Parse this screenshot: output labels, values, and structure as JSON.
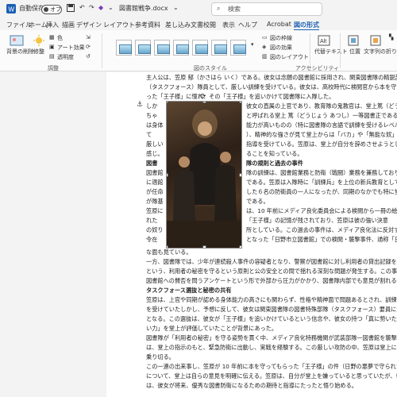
{
  "titlebar": {
    "autosave_label": "自動保存",
    "autosave_state": "オフ",
    "filename": "図書館戦争.docx",
    "search_placeholder": "検索"
  },
  "menus": [
    "ファイル",
    "ホーム",
    "挿入",
    "描画",
    "デザイン",
    "レイアウト",
    "参考資料",
    "差し込み文書",
    "校閲",
    "表示",
    "ヘルプ",
    "Acrobat",
    "図の形式"
  ],
  "active_menu": "図の形式",
  "ribbon": {
    "remove_bg": "背景の削除",
    "corrections": "修整",
    "color": "色",
    "art_effects": "アート効果",
    "transparency": "透明度",
    "group_adjust": "調整",
    "group_styles": "図のスタイル",
    "picture_border": "図の枠線",
    "picture_effects": "図の効果",
    "picture_layout": "図のレイアウト",
    "alt_text": "代替テキスト",
    "group_accessibility": "アクセシビリティ",
    "position": "位置",
    "wrap_text": "文字列の折り返し"
  },
  "doc": {
    "lines": [
      "主人公は、笠原 郁（かさはら いく）である。彼女は念願の図書館に採用され、関東図書隊の精鋭部隊",
      "（タスクフォース）隊員として、厳しい訓練を受けている。彼女は、高校時代に検閲官から本を守",
      "った「王子様」に憧れ、その「王子様」を追いかけて図書隊に入隊した。"
    ],
    "wrap_lines": [
      "しか",
      "ちゃ",
      "は身体",
      "て",
      "厳しい",
      "感じ。",
      "図書",
      "図書館",
      "に適館",
      "が任命",
      "が隊基",
      "笠原に",
      "れた",
      "の奴り",
      "令在"
    ],
    "right_lines": [
      "彼女の直属の上官であり、教育隊の鬼教官は、堂上篤（どうじょう あつし）",
      "と呼ばれる堂上 篤（どうじょう あつし）一等図書正である。",
      "能力が高いものの（特に図書隊の言語で訓練を受けるレベル",
      "）、精神的な強さが見て堂上からは「バカ」や「無能な奴」",
      "指導を受けている。笠原は、堂上が自分を辞めさせようとしてい",
      "ることを知っている。",
      "隊の規則と過去の事件",
      "隊の訓練は、図書館業務と防衛（戦闘）業務を兼務しており、",
      "である。笠原は入隊時に「訓練兵」を上位の新兵教育として、堂上",
      "した６名の防衛員の一人になったが、同期のなかでも特に堂上と",
      "である。",
      "は、10 年前にメディア良化委員会による検閲から一冊の絵本を",
      "「王子様」の記憶が残されており、笠原は彼の強い決意",
      "所としている。この過去の事件は、メディア良化法に反対するシン",
      "となった「日野市立図書館」での検閲・襲撃事件、通称「日野の"
    ],
    "bottom_lines": [
      "な面も見ている。",
      "一方、図書隊では、少年が連続殺人事件の容疑者となり、警察が図書館に対し利用者の貸出記録を要求",
      "という、利用者の秘密を守るという原則と公の安全との間で揺れる深刻な問題が発生する。この事件は、図",
      "図書館への賛否を問うアンケートという形で外部から圧力がかかり、図書隊内部でも意見が割れる微妙な状況",
      "タスクフォース選抜と秘密の共有",
      "笠原は、上官や同期が認める身体能力の高さにも関わらず、性格や精神面で問題あるとされ、訓練では厳",
      "を受けていたしかし、予想に反して、彼女は関東図書隊の図書特殊部隊（タスクフォース）要員に選抜",
      "となる。この選抜は、彼女が「王子様」を追いかけているという信念や、彼女の持つ「真に勢いた者にしか持",
      "い力」を堂上が評価していたことが背景にあった。",
      "図書隊が「利用者の秘密」を守る姿勢を貫く中、メディア良化特務機関が武装部隊一図書館を襲撃する。笠原",
      "は、堂上の指示のもと、緊急防衛に出動し、実戦を経験する。この厳しい攻防の中、笠原は堂上に支えられ",
      "乗り切る。",
      "この一連の出来事し、笠原が 10 年前に本を守ってもらった「王子様」の件（日野の悪夢で守られた小さな絵",
      "について、堂上は自らの意見を明確に伝える。笠原は、自分が堂上を嫌っていると思っていたが、彼からの評",
      "は、彼女が将来、優秀な図書防衛になるための期待と指導にたったと悟り始める。"
    ]
  }
}
